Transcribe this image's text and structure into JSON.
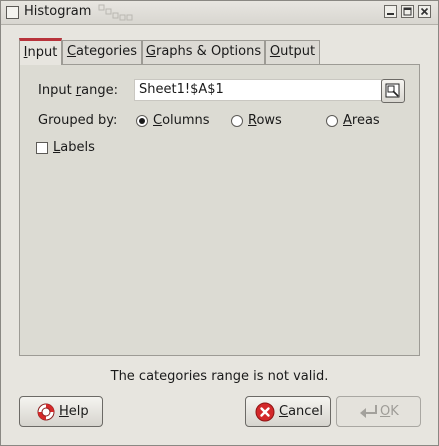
{
  "window": {
    "title": "Histogram"
  },
  "tabs": [
    {
      "label_pre": "",
      "label_u": "I",
      "label_post": "nput"
    },
    {
      "label_pre": "",
      "label_u": "C",
      "label_post": "ategories"
    },
    {
      "label_pre": "",
      "label_u": "G",
      "label_post": "raphs & Options"
    },
    {
      "label_pre": "",
      "label_u": "O",
      "label_post": "utput"
    }
  ],
  "input": {
    "range_label_pre": "Input ",
    "range_label_u": "r",
    "range_label_post": "ange:",
    "range_value": "Sheet1!$A$1",
    "grouped_label": "Grouped by:",
    "options": [
      {
        "u": "C",
        "rest": "olumns",
        "checked": true
      },
      {
        "u": "R",
        "rest": "ows",
        "checked": false
      },
      {
        "u": "A",
        "rest": "reas",
        "checked": false
      }
    ],
    "labels_u": "L",
    "labels_rest": "abels"
  },
  "status_text": "The categories range is not valid.",
  "buttons": {
    "help_u": "H",
    "help_rest": "elp",
    "cancel_u": "C",
    "cancel_rest": "ancel",
    "ok_u": "O",
    "ok_rest": "K"
  },
  "colors": {
    "active_tab_accent": "#b8333b",
    "cancel_icon": "#d3282a"
  }
}
